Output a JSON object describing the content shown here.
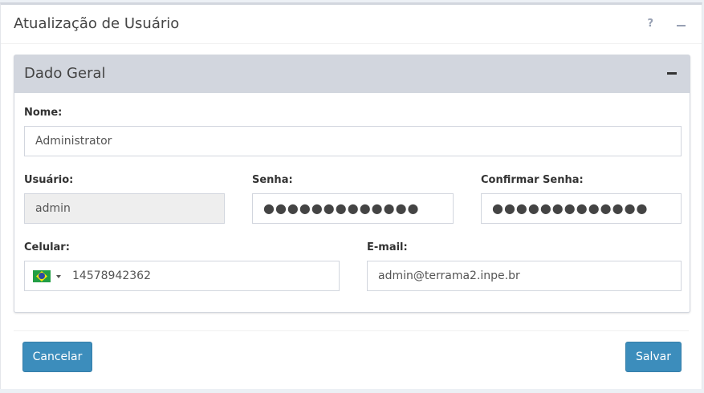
{
  "header": {
    "title": "Atualização de Usuário",
    "help_label": "?"
  },
  "section": {
    "title": "Dado Geral"
  },
  "form": {
    "name_label": "Nome:",
    "name_value": "Administrator",
    "username_label": "Usuário:",
    "username_value": "admin",
    "password_label": "Senha:",
    "password_value": "●●●●●●●●●●●●●",
    "confirm_label": "Confirmar Senha:",
    "confirm_value": "●●●●●●●●●●●●●",
    "phone_label": "Celular:",
    "phone_value": "14578942362",
    "phone_country_icon": "brazil-flag-icon",
    "email_label": "E-mail:",
    "email_value": "admin@terrama2.inpe.br"
  },
  "buttons": {
    "cancel": "Cancelar",
    "save": "Salvar"
  },
  "colors": {
    "primary_button": "#3c8dbc",
    "section_header": "#d2d6de",
    "readonly_field": "#eeeeee"
  }
}
